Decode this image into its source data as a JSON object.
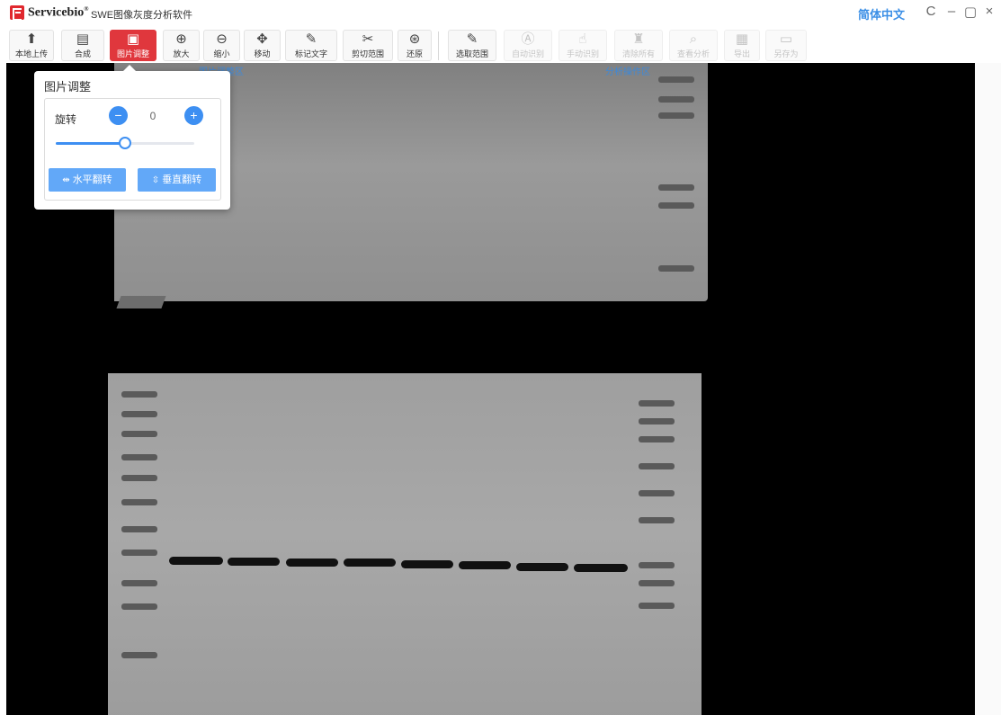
{
  "titlebar": {
    "brand": "Servicebio",
    "brand_mark": "®",
    "app_title": "SWE图像灰度分析软件",
    "language": "简体中文",
    "icons": [
      "refresh-icon",
      "minimize-icon",
      "maximize-icon",
      "close-icon"
    ],
    "refresh_glyph": "C",
    "minimize_glyph": "–",
    "maximize_glyph": "▢",
    "close_glyph": "×"
  },
  "toolbar": {
    "items": [
      {
        "label": "本地上传",
        "icon": "upload-icon",
        "glyph": "⬆",
        "state": "normal"
      },
      {
        "label": "合成",
        "icon": "merge-icon",
        "glyph": "▤",
        "state": "normal"
      },
      {
        "label": "图片调整",
        "icon": "image-adjust-icon",
        "glyph": "▣",
        "state": "active"
      },
      {
        "label": "放大",
        "icon": "zoom-in-icon",
        "glyph": "⊕",
        "state": "normal"
      },
      {
        "label": "缩小",
        "icon": "zoom-out-icon",
        "glyph": "⊖",
        "state": "normal"
      },
      {
        "label": "移动",
        "icon": "move-icon",
        "glyph": "✥",
        "state": "normal"
      },
      {
        "label": "标记文字",
        "icon": "edit-text-icon",
        "glyph": "✎",
        "state": "normal"
      },
      {
        "label": "剪切范围",
        "icon": "scissors-icon",
        "glyph": "✂",
        "state": "normal"
      },
      {
        "label": "还原",
        "icon": "restore-icon",
        "glyph": "⊛",
        "state": "normal"
      },
      {
        "label": "选取范围",
        "icon": "select-range-icon",
        "glyph": "✎",
        "state": "normal"
      },
      {
        "label": "自动识别",
        "icon": "auto-detect-icon",
        "glyph": "Ⓐ",
        "state": "disabled"
      },
      {
        "label": "手动识别",
        "icon": "manual-detect-icon",
        "glyph": "☝",
        "state": "disabled"
      },
      {
        "label": "清除所有",
        "icon": "clear-all-icon",
        "glyph": "♜",
        "state": "disabled"
      },
      {
        "label": "查看分析",
        "icon": "view-analysis-icon",
        "glyph": "⌕",
        "state": "disabled"
      },
      {
        "label": "导出",
        "icon": "export-icon",
        "glyph": "▦",
        "state": "disabled"
      },
      {
        "label": "另存为",
        "icon": "save-as-icon",
        "glyph": "▭",
        "state": "disabled"
      }
    ],
    "zone_left": "图片调整区",
    "zone_right": "分析操作区"
  },
  "panel": {
    "title": "图片调整",
    "rotation_label": "旋转",
    "rotation_value": "0",
    "minus_glyph": "−",
    "plus_glyph": "+",
    "slider_fraction": 0.5,
    "flip_h_label": "水平翻转",
    "flip_h_glyph": "⇹",
    "flip_v_label": "垂直翻转",
    "flip_v_glyph": "⇳"
  },
  "colors": {
    "accent": "#3d8ff2",
    "active_tool": "#e0373d",
    "brand_red": "#e0282e",
    "language": "#3b8fe6"
  }
}
